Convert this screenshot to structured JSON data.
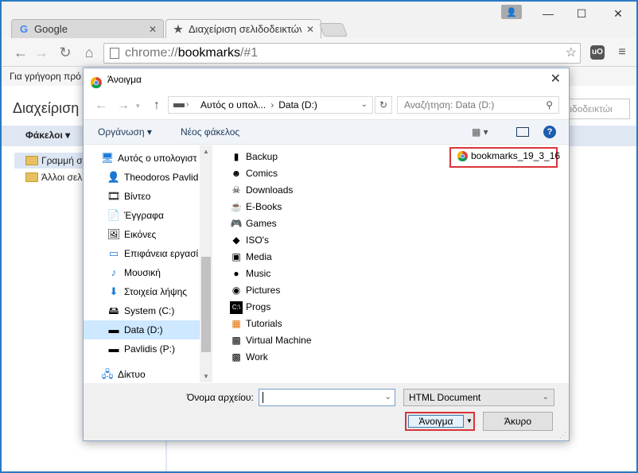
{
  "browser": {
    "tabs": [
      {
        "title": "Google",
        "icon": "google-g-icon"
      },
      {
        "title": "Διαχείριση σελιδοδεικτών",
        "icon": "star-icon"
      }
    ],
    "address": {
      "scheme": "chrome://",
      "host": "bookmarks",
      "path": "/#1"
    },
    "bookmarks_bar_text": "Για γρήγορη πρό"
  },
  "bookmarks_page": {
    "title": "Διαχείριση",
    "search_placeholder": "ελιδοδεικτώι",
    "folders_label": "Φάκελοι ▾",
    "items": [
      "Γραμμή σ",
      "Άλλοι σελ"
    ]
  },
  "dialog": {
    "title": "Άνοιγμα",
    "breadcrumb": [
      "Αυτός ο υπολ...",
      "Data (D:)"
    ],
    "search_placeholder": "Αναζήτηση: Data (D:)",
    "organize_label": "Οργάνωση ▾",
    "new_folder_label": "Νέος φάκελος",
    "nav_tree": [
      {
        "label": "Αυτός ο υπολογιστ",
        "icon": "computer-icon"
      },
      {
        "label": "Theodoros Pavlid",
        "icon": "user-folder-icon"
      },
      {
        "label": "Βίντεο",
        "icon": "video-icon"
      },
      {
        "label": "Έγγραφα",
        "icon": "documents-icon"
      },
      {
        "label": "Εικόνες",
        "icon": "pictures-icon"
      },
      {
        "label": "Επιφάνεια εργασί",
        "icon": "desktop-icon"
      },
      {
        "label": "Μουσική",
        "icon": "music-icon"
      },
      {
        "label": "Στοιχεία λήψης",
        "icon": "download-icon"
      },
      {
        "label": "System (C:)",
        "icon": "drive-icon"
      },
      {
        "label": "Data (D:)",
        "icon": "drive-icon"
      },
      {
        "label": "Pavlidis (P:)",
        "icon": "network-drive-icon"
      },
      {
        "label": "Δίκτυο",
        "icon": "network-icon"
      }
    ],
    "files": [
      {
        "label": "Backup",
        "icon": "backup-folder-icon"
      },
      {
        "label": "Comics",
        "icon": "comics-folder-icon"
      },
      {
        "label": "Downloads",
        "icon": "downloads-folder-icon"
      },
      {
        "label": "E-Books",
        "icon": "ebooks-folder-icon"
      },
      {
        "label": "Games",
        "icon": "games-folder-icon"
      },
      {
        "label": "ISO's",
        "icon": "iso-folder-icon"
      },
      {
        "label": "Media",
        "icon": "media-folder-icon"
      },
      {
        "label": "Music",
        "icon": "music-folder-icon"
      },
      {
        "label": "Pictures",
        "icon": "pictures-folder-icon"
      },
      {
        "label": "Progs",
        "icon": "progs-folder-icon"
      },
      {
        "label": "Tutorials",
        "icon": "tutorials-folder-icon"
      },
      {
        "label": "Virtual Machine",
        "icon": "vm-folder-icon"
      },
      {
        "label": "Work",
        "icon": "work-folder-icon"
      }
    ],
    "highlight_file": "bookmarks_19_3_16",
    "filename_label": "Όνομα αρχείου:",
    "filename_value": "",
    "filetype_value": "HTML Document",
    "open_button": "Άνοιγμα",
    "cancel_button": "Άκυρο"
  }
}
